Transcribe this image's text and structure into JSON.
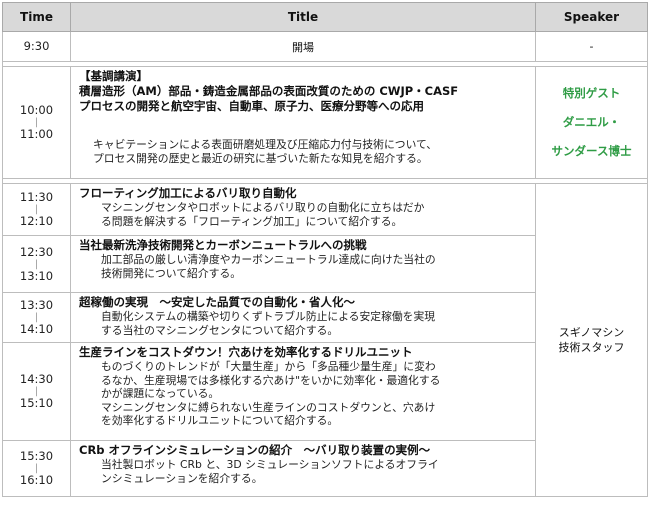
{
  "headers": {
    "time": "Time",
    "title": "Title",
    "speaker": "Speaker"
  },
  "row_open": {
    "time": "9:30",
    "title": "開場",
    "speaker": "-"
  },
  "keynote": {
    "time_start": "10:00",
    "time_end": "11:00",
    "label": "【基調講演】",
    "title_line1": "積層造形（AM）部品・鋳造金属部品の表面改質のための CWJP・CASF",
    "title_line2": "プロセスの開発と航空宇宙、自動車、原子力、医療分野等への応用",
    "desc_line1": "キャビテーションによる表面研磨処理及び圧縮応力付与技術について、",
    "desc_line2": "プロセス開発の歴史と最近の研究に基づいた新たな知見を紹介する。",
    "speaker_line1": "特別ゲスト",
    "speaker_line2": "ダニエル・",
    "speaker_line3": "サンダース博士"
  },
  "speaker_staff": {
    "line1": "スギノマシン",
    "line2": "技術スタッフ"
  },
  "sessions": [
    {
      "time_start": "11:30",
      "time_end": "12:10",
      "title": "フローティング加工によるバリ取り自動化",
      "desc_line1": "マシニングセンタやロボットによるバリ取りの自動化に立ちはだか",
      "desc_line2": "る問題を解決する「フローティング加工」について紹介する。"
    },
    {
      "time_start": "12:30",
      "time_end": "13:10",
      "title": "当社最新洗浄技術開発とカーボンニュートラルへの挑戦",
      "desc_line1": "加工部品の厳しい清浄度やカーボンニュートラル達成に向けた当社の",
      "desc_line2": "技術開発について紹介する。"
    },
    {
      "time_start": "13:30",
      "time_end": "14:10",
      "title": "超稼働の実現　～安定した品質での自動化・省人化～",
      "desc_line1": "自動化システムの構築や切りくずトラブル防止による安定稼働を実現",
      "desc_line2": "する当社のマシニングセンタについて紹介する。"
    },
    {
      "time_start": "14:30",
      "time_end": "15:10",
      "title": "生産ラインをコストダウン！穴あけを効率化するドリルユニット",
      "desc_line1": "ものづくりのトレンドが「大量生産」から「多品種少量生産」に変わ",
      "desc_line2": "るなか、生産現場では多様化する穴あけ\"をいかに効率化・最適化する",
      "desc_line3": "かが課題になっている。",
      "desc_line4": "マシニングセンタに縛られない生産ラインのコストダウンと、穴あけ",
      "desc_line5": "を効率化するドリルユニットについて紹介する。"
    },
    {
      "time_start": "15:30",
      "time_end": "16:10",
      "title": "CRb オフラインシミュレーションの紹介　～バリ取り装置の実例～",
      "desc_line1": "当社製ロボット CRb と、3D シミュレーションソフトによるオフライ",
      "desc_line2": "ンシミュレーションを紹介する。"
    }
  ]
}
